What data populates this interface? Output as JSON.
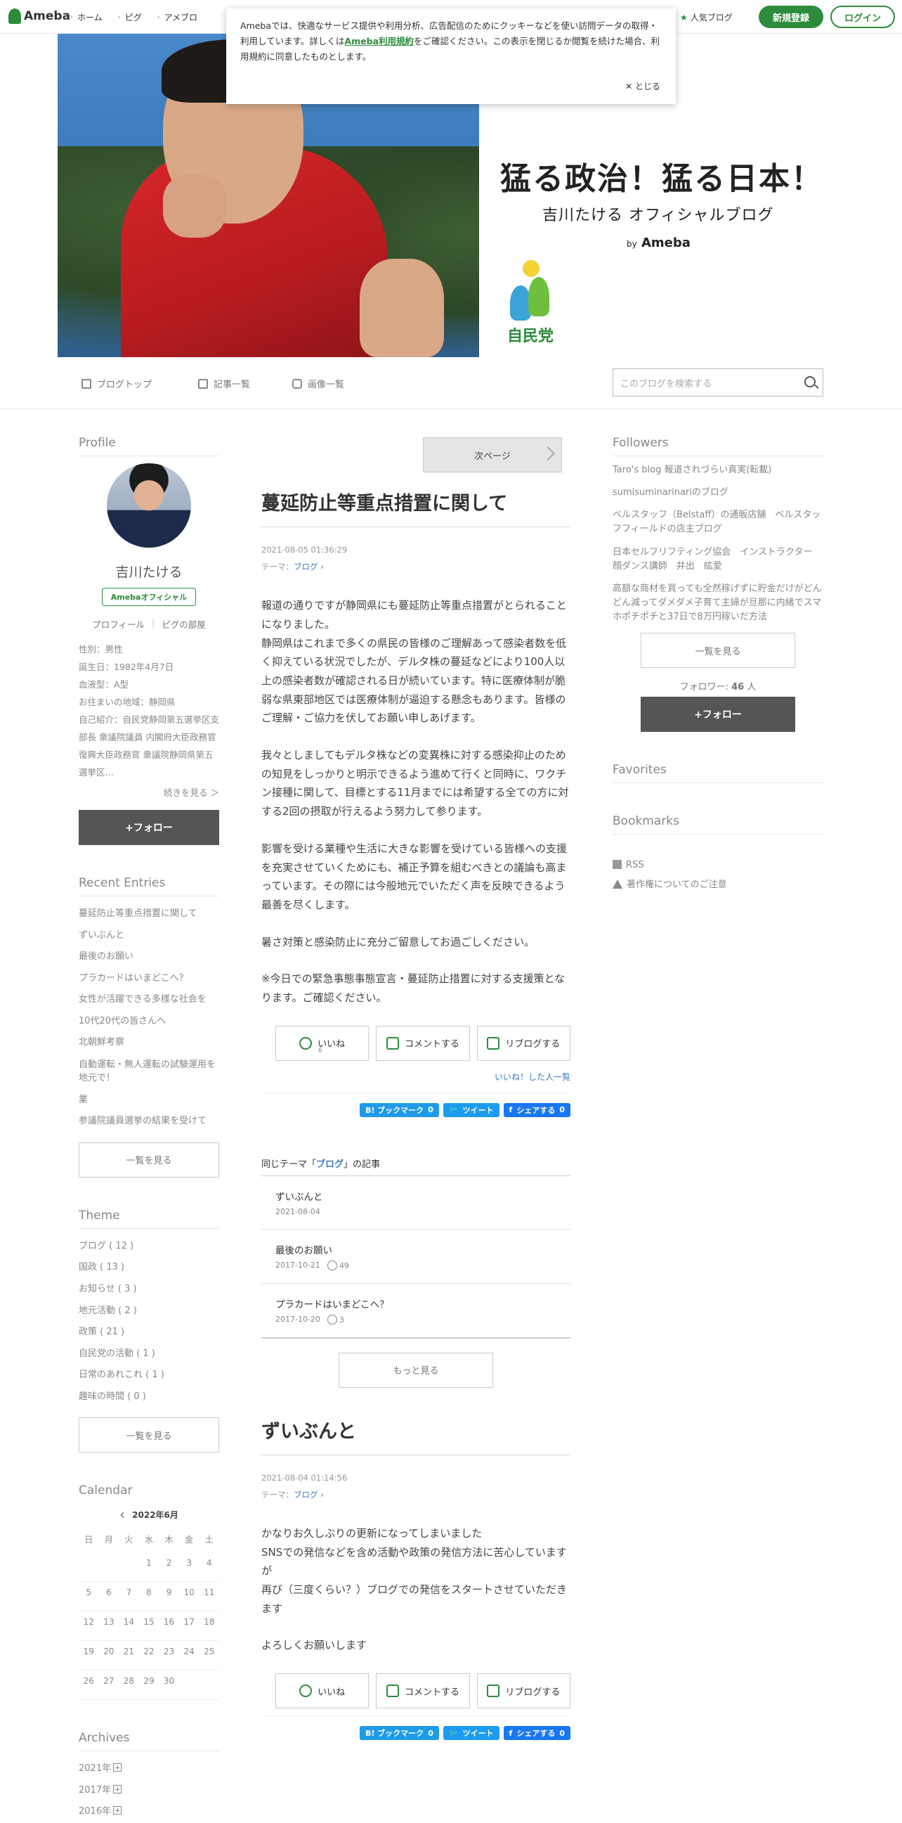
{
  "topbar": {
    "logo": "Ameba",
    "nav": [
      "ホーム",
      "ピグ",
      "アメブロ"
    ],
    "rank": "人気ブログ",
    "register": "新規登録",
    "login": "ログイン"
  },
  "cookie": {
    "text1": "Amebaでは、快適なサービス提供や利用分析、広告配信のためにクッキーなどを使い訪問データの取得・利用しています。詳しくは",
    "link": "Ameba利用規約",
    "text2": "をご確認ください。この表示を閉じるか閲覧を続けた場合、利用規約に同意したものとします。",
    "close": "とじる"
  },
  "hero": {
    "title": "猛る政治！猛る日本！",
    "subtitle": "吉川たける オフィシャルブログ",
    "by": "by",
    "brand": "Ameba",
    "party": "自民党"
  },
  "subnav": {
    "top": "ブログトップ",
    "entries": "記事一覧",
    "images": "画像一覧",
    "search_placeholder": "このブログを検索する"
  },
  "profile": {
    "heading": "Profile",
    "name": "吉川たける",
    "badge": "Amebaオフィシャル",
    "link_profile": "プロフィール",
    "link_pig": "ピグの部屋",
    "info": [
      "性別：男性",
      "誕生日：1982年4月7日",
      "血液型：A型",
      "お住まいの地域：静岡県",
      "自己紹介：自民党静岡第五選挙区支部長 衆議院議員 内閣府大臣政務官 復興大臣政務官 衆議院静岡県第五選挙区…"
    ],
    "more": "続きを見る ＞",
    "follow": "+フォロー"
  },
  "recent": {
    "heading": "Recent Entries",
    "items": [
      "蔓延防止等重点措置に関して",
      "ずいぶんと",
      "最後のお願い",
      "プラカードはいまどこへ？",
      "女性が活躍できる多様な社会を",
      "10代20代の皆さんへ",
      "北朝鮮考察",
      "自動運転・無人運転の試験運用を地元で！",
      "業",
      "参議院議員選挙の結果を受けて"
    ],
    "more": "一覧を見る"
  },
  "theme": {
    "heading": "Theme",
    "items": [
      "ブログ ( 12 )",
      "国政 ( 13 )",
      "お知らせ ( 3 )",
      "地元活動 ( 2 )",
      "政策 ( 21 )",
      "自民党の活動 ( 1 )",
      "日常のあれこれ ( 1 )",
      "趣味の時間 ( 0 )"
    ],
    "more": "一覧を見る"
  },
  "calendar": {
    "heading": "Calendar",
    "month": "2022年6月",
    "dow": [
      "日",
      "月",
      "火",
      "水",
      "木",
      "金",
      "土"
    ],
    "days": [
      "",
      "",
      "",
      "1",
      "2",
      "3",
      "4",
      "5",
      "6",
      "7",
      "8",
      "9",
      "10",
      "11",
      "12",
      "13",
      "14",
      "15",
      "16",
      "17",
      "18",
      "19",
      "20",
      "21",
      "22",
      "23",
      "24",
      "25",
      "26",
      "27",
      "28",
      "29",
      "30",
      "",
      ""
    ]
  },
  "archives": {
    "heading": "Archives",
    "items": [
      "2021年",
      "2017年",
      "2016年"
    ]
  },
  "entry": {
    "next": "次ページ",
    "title": "蔓延防止等重点措置に関して",
    "date": "2021-08-05 01:36:29",
    "theme_label": "テーマ：",
    "theme": "ブログ",
    "paragraphs": [
      "報道の通りですが静岡県にも蔓延防止等重点措置がとられることになりました。\n静岡県はこれまで多くの県民の皆様のご理解あって感染者数を低く抑えている状況でしたが、デルタ株の蔓延などにより100人以上の感染者数が確認される日が続いています。特に医療体制が脆弱な県東部地区では医療体制が逼迫する懸念もあります。皆様のご理解・ご協力を伏してお願い申しあげます。",
      "我々としましてもデルタ株などの変異株に対する感染抑止のための知見をしっかりと明示できるよう進めて行くと同時に、ワクチン接種に関して、目標とする11月までには希望する全ての方に対する2回の摂取が行えるよう努力して参ります。",
      "影響を受ける業種や生活に大きな影響を受けている皆様への支援を充実させていくためにも、補正予算を組むべきとの議論も高まっています。その際には今般地元でいただく声を反映できるよう最善を尽くします。",
      "暑さ対策と感染防止に充分ご留意してお過ごしください。",
      "※今日での緊急事態事態宣言・蔓延防止措置に対する支援策となります。ご確認ください。"
    ],
    "like": "いいね",
    "like_count": "6",
    "comment": "コメントする",
    "reblog": "リブログする",
    "likers": "いいね！した人一覧",
    "share_hb": "B! ブックマーク",
    "share_hb_count": "0",
    "share_tw": "ツイート",
    "share_fb": "シェアする",
    "share_fb_count": "0"
  },
  "same_theme": {
    "prefix": "同じテーマ「",
    "theme": "ブログ",
    "suffix": "」の記事",
    "items": [
      {
        "title": "ずいぶんと",
        "date": "2021-08-04",
        "likes": ""
      },
      {
        "title": "最後のお願い",
        "date": "2017-10-21",
        "likes": "49"
      },
      {
        "title": "プラカードはいまどこへ？",
        "date": "2017-10-20",
        "likes": "3"
      }
    ],
    "more": "もっと見る"
  },
  "entry2": {
    "title": "ずいぶんと",
    "date": "2021-08-04 01:14:56",
    "theme_label": "テーマ：",
    "theme": "ブログ",
    "paragraphs": [
      "かなりお久しぶりの更新になってしまいました\nSNSでの発信などを含め活動や政策の発信方法に苦心していますが\n再び（三度くらい？）ブログでの発信をスタートさせていただきます",
      "よろしくお願いします"
    ],
    "like": "いいね",
    "comment": "コメントする",
    "reblog": "リブログする",
    "share_hb": "B! ブックマーク",
    "share_hb_count": "0",
    "share_tw": "ツイート",
    "share_fb": "シェアする",
    "share_fb_count": "0"
  },
  "followers": {
    "heading": "Followers",
    "items": [
      "Taro's blog 報道されづらい真実(転載)",
      "sumisuminarinariのブログ",
      "ベルスタッフ（Belstaff）の通販店舗　ベルスタッフフィールドの店主ブログ",
      "日本セルフリフティング協会　インストラクター 顔ダンス講師　井出　紘愛",
      "高額な商材を買っても全然稼げずに貯金だけがどんどん減ってダメダメ子育て主婦が旦那に内緒でスマホポチポチと37日で8万円稼いだ方法"
    ],
    "more": "一覧を見る",
    "count_label": "フォロワー:",
    "count": "46",
    "count_unit": "人",
    "follow": "+フォロー"
  },
  "favorites": {
    "heading": "Favorites"
  },
  "bookmarks": {
    "heading": "Bookmarks"
  },
  "footer_links": {
    "rss": "RSS",
    "copyright": "著作権についてのご注意"
  }
}
